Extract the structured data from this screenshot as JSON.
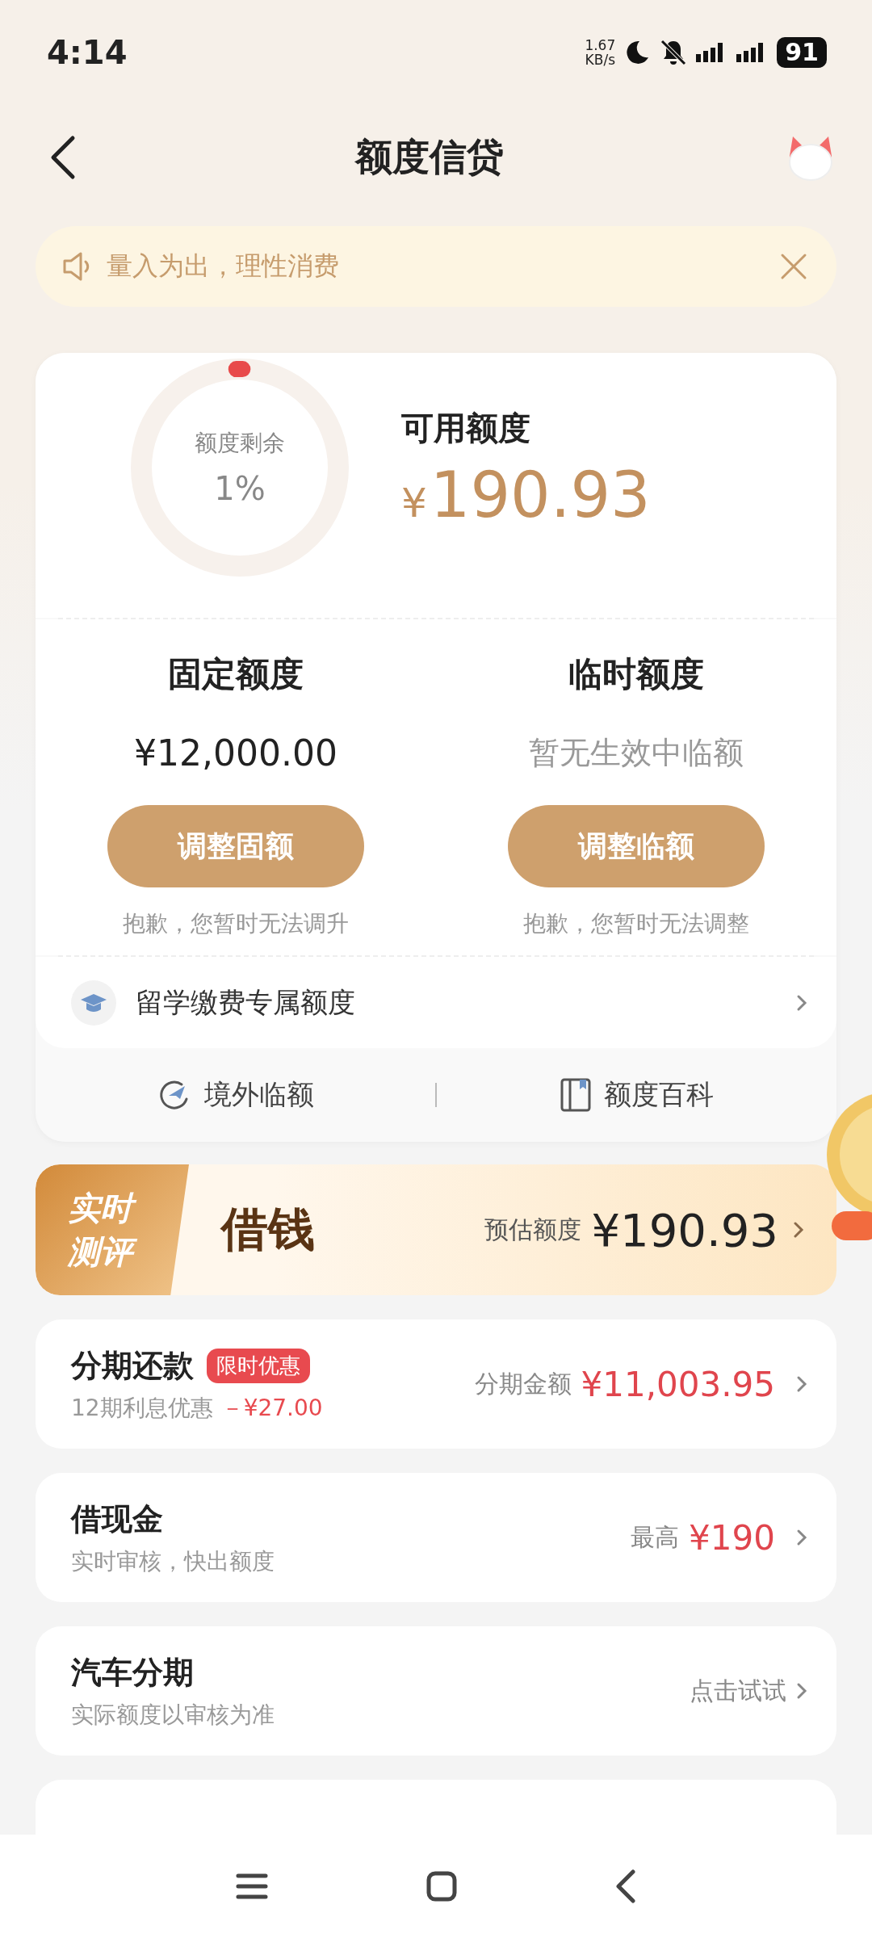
{
  "status_bar": {
    "time": "4:14",
    "net_speed_value": "1.67",
    "net_speed_unit": "KB/s",
    "battery": "91"
  },
  "nav": {
    "title": "额度信贷"
  },
  "notice": {
    "text": "量入为出，理性消费"
  },
  "quota": {
    "ring_label": "额度剩余",
    "ring_value": "1%",
    "level": 0.01,
    "available_label": "可用额度",
    "currency": "¥",
    "available_amount": "190.93"
  },
  "limits": [
    {
      "title": "固定额度",
      "kind": "amount",
      "value": "¥12,000.00",
      "button": "调整固额",
      "note": "抱歉，您暂时无法调升"
    },
    {
      "title": "临时额度",
      "kind": "empty",
      "value": "暂无生效中临额",
      "button": "调整临额",
      "note": "抱歉，您暂时无法调整"
    }
  ],
  "study_link": {
    "label": "留学缴费专属额度"
  },
  "shortcuts": [
    {
      "kind": "plane",
      "label": "境外临额"
    },
    {
      "kind": "book",
      "label": "额度百科"
    }
  ],
  "promo": {
    "tag_lines": [
      "实时",
      "测评"
    ],
    "title": "借钱",
    "estimate_label": "预估额度",
    "estimate_amount": "¥190.93"
  },
  "products": [
    {
      "title": "分期还款",
      "badge": "限时优惠",
      "subtitle": "12期利息优惠",
      "discount": "－¥27.00",
      "right_label": "分期金额",
      "right_value": "¥11,003.95"
    },
    {
      "title": "借现金",
      "subtitle": "实时审核，快出额度",
      "right_label": "最高",
      "right_value": "¥190"
    },
    {
      "title": "汽车分期",
      "subtitle": "实际额度以审核为准",
      "right_label": "点击试试"
    }
  ]
}
